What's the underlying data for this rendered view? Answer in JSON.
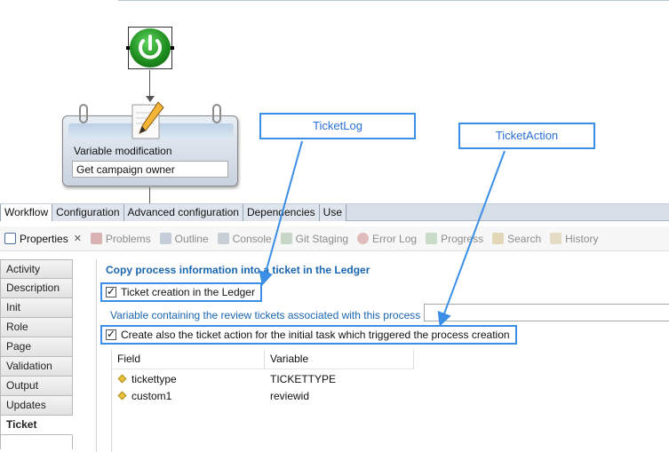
{
  "canvas": {
    "task_node": {
      "title": "Variable modification",
      "subtitle": "Get campaign owner"
    }
  },
  "callouts": {
    "ticket_log": "TicketLog",
    "ticket_action": "TicketAction"
  },
  "editor_tabs": [
    "Workflow",
    "Configuration",
    "Advanced configuration",
    "Dependencies",
    "Use"
  ],
  "view_tabs": [
    {
      "label": "Properties",
      "icon": "properties-icon"
    },
    {
      "label": "Problems",
      "icon": "problems-icon"
    },
    {
      "label": "Outline",
      "icon": "outline-icon"
    },
    {
      "label": "Console",
      "icon": "console-icon"
    },
    {
      "label": "Git Staging",
      "icon": "git-staging-icon"
    },
    {
      "label": "Error Log",
      "icon": "error-log-icon"
    },
    {
      "label": "Progress",
      "icon": "progress-icon"
    },
    {
      "label": "Search",
      "icon": "search-icon"
    },
    {
      "label": "History",
      "icon": "history-icon"
    }
  ],
  "side_tabs": [
    "Activity",
    "Description",
    "Init",
    "Role",
    "Page",
    "Validation",
    "Output",
    "Updates",
    "Ticket"
  ],
  "panel": {
    "section_title": "Copy process information into a ticket in the Ledger",
    "ticket_creation_label": "Ticket creation in the Ledger",
    "variable_label": "Variable containing the review tickets associated with this process",
    "ticket_action_label": "Create also the ticket action for the initial task which triggered the process creation",
    "table": {
      "headers": [
        "Field",
        "Variable"
      ],
      "rows": [
        {
          "field": "tickettype",
          "variable": "TICKETTYPE"
        },
        {
          "field": "custom1",
          "variable": "reviewid"
        }
      ]
    }
  },
  "colors": {
    "accent_blue": "#3b8fe6",
    "section_title": "#1a66b0",
    "start_green": "#1f8f1f"
  }
}
